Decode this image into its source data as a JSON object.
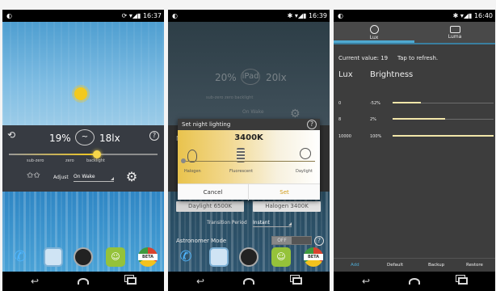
{
  "screens": [
    {
      "status": {
        "time": "16:37"
      },
      "main": {
        "brightness": "19%",
        "lux": "18lx",
        "mode_icon": "~",
        "scale_labels": [
          "sub-zero",
          "zero",
          "backlight"
        ],
        "adjust_label": "Adjust",
        "adjust_value": "On Wake",
        "help": "?"
      },
      "dock": {
        "beta": "BETA"
      }
    },
    {
      "status": {
        "time": "16:39"
      },
      "background": {
        "brightness": "20%",
        "lux": "20lx",
        "mode_icon": "iPad",
        "scale_text": "sub-zero    zero    backlight",
        "adjust_value": "On Wake",
        "n_label": "N"
      },
      "dialog": {
        "title": "Set night lighting",
        "help": "?",
        "kelvin": "3400K",
        "labels": [
          "Halogen",
          "Fluorescent",
          "Daylight"
        ],
        "cancel": "Cancel",
        "set": "Set"
      },
      "presets": [
        "Daylight 6500K",
        "Halogen 3400K"
      ],
      "transition_label": "Transition Period",
      "transition_value": "Instant",
      "astronomer_label": "Astronomer Mode",
      "astronomer_toggle": "OFF",
      "help": "?",
      "dock": {
        "beta": "BETA"
      }
    },
    {
      "status": {
        "time": "16:40"
      },
      "tabs": [
        "Lux",
        "Luma"
      ],
      "current_value": "Current value: 19",
      "refresh_hint": "Tap to refresh.",
      "headers": {
        "lux": "Lux",
        "brightness": "Brightness"
      },
      "rows": [
        {
          "lux": "0",
          "brightness": "-52%",
          "level": 0.28
        },
        {
          "lux": "8",
          "brightness": "2%",
          "level": 0.52
        },
        {
          "lux": "10000",
          "brightness": "100%",
          "level": 1.0
        }
      ],
      "actions": [
        "Add",
        "Default",
        "Backup",
        "Restore"
      ]
    }
  ],
  "colors": {
    "accent_blue": "#4fa9d1",
    "sun_yellow": "#f3c91e",
    "set_orange": "#d19b16"
  }
}
